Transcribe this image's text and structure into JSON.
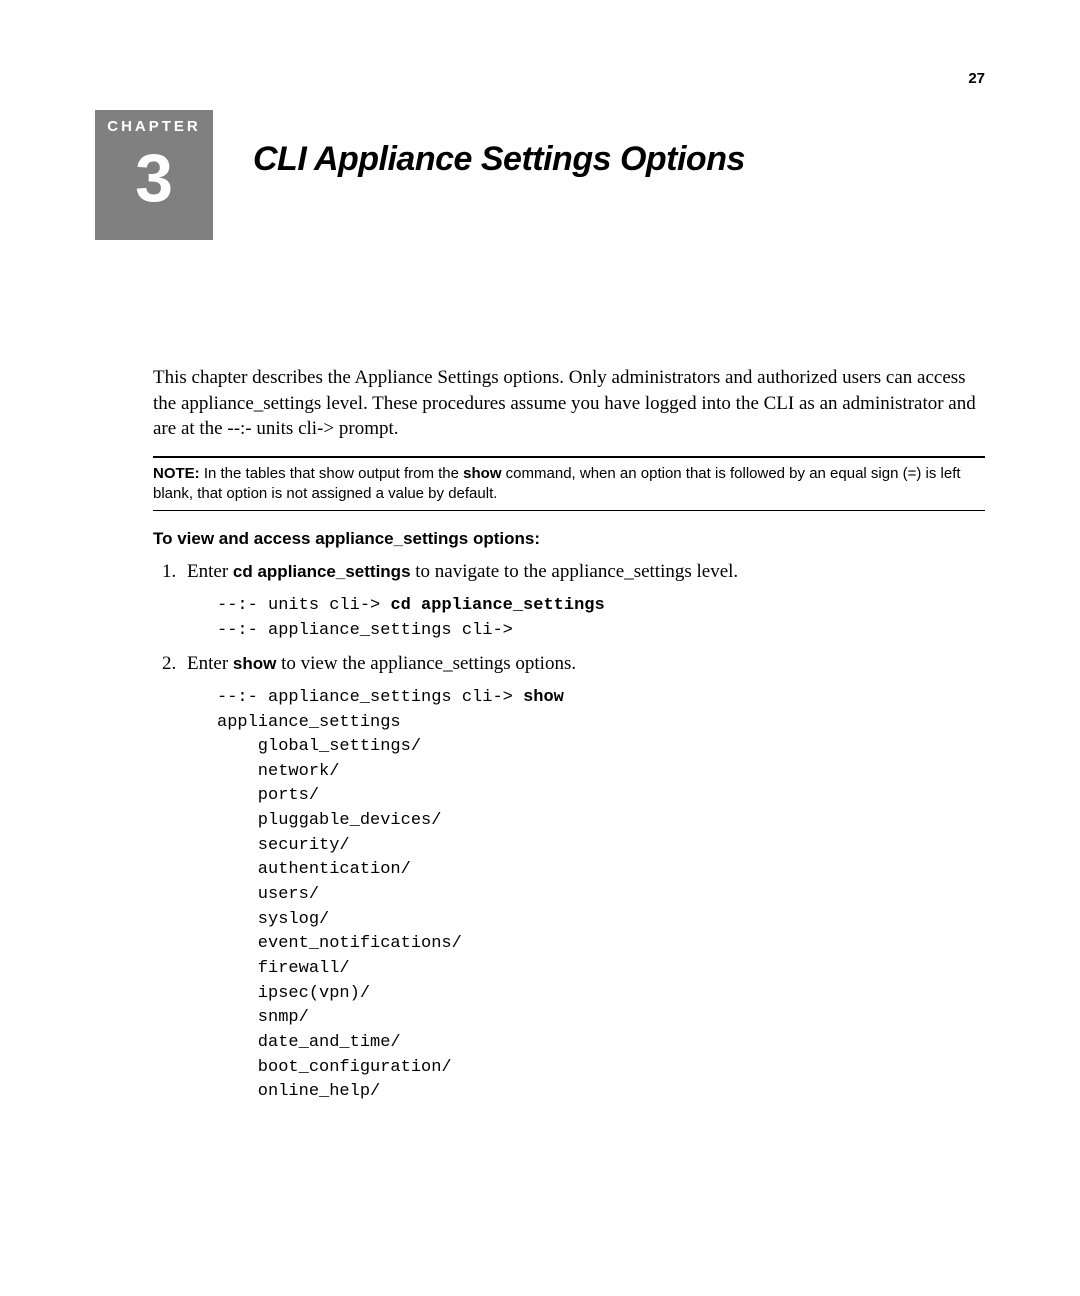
{
  "page_number": "27",
  "chapter": {
    "label": "CHAPTER",
    "number": "3",
    "title": "CLI Appliance Settings Options"
  },
  "intro": "This chapter describes the Appliance Settings options. Only administrators and authorized users can access the appliance_settings level. These procedures assume you have logged into the CLI as an administrator and are at the --:- units cli-> prompt.",
  "note": {
    "label": "NOTE:",
    "before_show": " In the tables that show output from the ",
    "show_word": "show",
    "after_show": " command, when an option that is followed by an equal sign (=) is left blank, that option is not assigned a value by default."
  },
  "section_heading": "To view and access appliance_settings options:",
  "steps": [
    {
      "before_cmd": "Enter ",
      "cmd": "cd appliance_settings",
      "after_cmd": " to navigate to the appliance_settings level."
    },
    {
      "before_cmd": "Enter ",
      "cmd": "show",
      "after_cmd": " to view the appliance_settings options."
    }
  ],
  "code1": {
    "prompt1": "--:- units cli-> ",
    "cmd1": "cd appliance_settings",
    "line2": "--:- appliance_settings cli->"
  },
  "code2": {
    "prompt": "--:- appliance_settings cli-> ",
    "cmd": "show",
    "body": "appliance_settings\n    global_settings/\n    network/\n    ports/\n    pluggable_devices/\n    security/\n    authentication/\n    users/\n    syslog/\n    event_notifications/\n    firewall/\n    ipsec(vpn)/\n    snmp/\n    date_and_time/\n    boot_configuration/\n    online_help/"
  }
}
